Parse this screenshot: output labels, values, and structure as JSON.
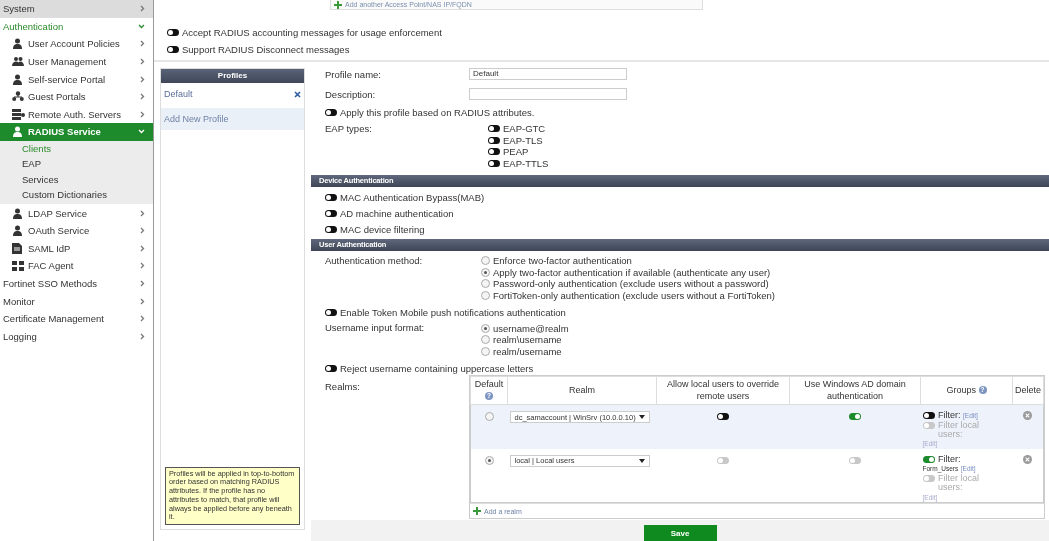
{
  "sidebar": {
    "items": [
      {
        "label": "System",
        "expanded": false,
        "hovered": true
      },
      {
        "label": "Authentication",
        "expanded": true,
        "hovered": false,
        "children": [
          {
            "label": "User Account Policies",
            "expanded": false,
            "selected": false
          },
          {
            "label": "User Management",
            "expanded": false,
            "selected": false
          },
          {
            "label": "Self-service Portal",
            "expanded": false,
            "selected": false
          },
          {
            "label": "Guest Portals",
            "expanded": false,
            "selected": false
          },
          {
            "label": "Remote Auth. Servers",
            "expanded": false,
            "selected": false
          },
          {
            "label": "RADIUS Service",
            "expanded": true,
            "selected": true,
            "children": [
              {
                "label": "Clients",
                "selected": true
              },
              {
                "label": "EAP",
                "selected": false
              },
              {
                "label": "Services",
                "selected": false
              },
              {
                "label": "Custom Dictionaries",
                "selected": false
              }
            ]
          },
          {
            "label": "LDAP Service",
            "expanded": false,
            "selected": false
          },
          {
            "label": "OAuth Service",
            "expanded": false,
            "selected": false
          },
          {
            "label": "SAML IdP",
            "expanded": false,
            "selected": false
          },
          {
            "label": "FAC Agent",
            "expanded": false,
            "selected": false
          }
        ]
      },
      {
        "label": "Fortinet SSO Methods",
        "expanded": false,
        "hovered": false
      },
      {
        "label": "Monitor",
        "expanded": false,
        "hovered": false
      },
      {
        "label": "Certificate Management",
        "expanded": false,
        "hovered": false
      },
      {
        "label": "Logging",
        "expanded": false,
        "hovered": false
      }
    ]
  },
  "top": {
    "add_link": "Add another Access Point/NAS IP/FQDN",
    "toggles": [
      {
        "label": "Accept RADIUS accounting messages for usage enforcement",
        "on": false
      },
      {
        "label": "Support RADIUS Disconnect messages",
        "on": false
      }
    ]
  },
  "profiles": {
    "title": "Profiles",
    "items": [
      {
        "label": "Default"
      }
    ],
    "add_label": "Add New Profile",
    "note": "Profiles will be applied in top-to-bottom order based on matching RADIUS attributes. If the profile has no attributes to match, that profile will always be applied before any beneath it."
  },
  "form": {
    "profile_name": {
      "label": "Profile name:",
      "value": "Default"
    },
    "description": {
      "label": "Description:"
    },
    "apply_toggle": {
      "label": "Apply this profile based on RADIUS attributes.",
      "on": false
    },
    "eap_types": {
      "label": "EAP types:",
      "options": [
        {
          "label": "EAP-GTC",
          "on": false
        },
        {
          "label": "EAP-TLS",
          "on": false
        },
        {
          "label": "PEAP",
          "on": false
        },
        {
          "label": "EAP-TTLS",
          "on": false
        }
      ]
    },
    "device_authentication": {
      "title": "Device Authentication",
      "toggles": [
        {
          "label": "MAC Authentication Bypass(MAB)",
          "on": false
        },
        {
          "label": "AD machine authentication",
          "on": false
        },
        {
          "label": "MAC device filtering",
          "on": false
        }
      ]
    },
    "user_authentication": {
      "title": "User Authentication",
      "authentication_method": {
        "label": "Authentication method:",
        "options": [
          {
            "label": "Enforce two-factor authentication",
            "selected": false
          },
          {
            "label": "Apply two-factor authentication if available (authenticate any user)",
            "selected": true
          },
          {
            "label": "Password-only authentication (exclude users without a password)",
            "selected": false
          },
          {
            "label": "FortiToken-only authentication (exclude users without a FortiToken)",
            "selected": false
          }
        ]
      },
      "token_toggle": {
        "label": "Enable Token Mobile push notifications authentication",
        "on": false
      },
      "username_format": {
        "label": "Username input format:",
        "options": [
          {
            "label": "username@realm",
            "selected": true
          },
          {
            "label": "realm\\username",
            "selected": false
          },
          {
            "label": "realm/username",
            "selected": false
          }
        ]
      },
      "reject_toggle": {
        "label": "Reject username containing uppercase letters",
        "on": false
      },
      "realms": {
        "label": "Realms:",
        "columns": [
          {
            "label": "Default",
            "help": "?"
          },
          {
            "label": "Realm"
          },
          {
            "label": "Allow local users to override remote users"
          },
          {
            "label": "Use Windows AD domain authentication"
          },
          {
            "label": "Groups",
            "help": "?"
          },
          {
            "label": "Delete"
          }
        ],
        "rows": [
          {
            "selected": false,
            "highlighted": true,
            "realm": "dc_samaccount | WinSrv (10.0.0.10)",
            "override": {
              "on": false,
              "disabled": false
            },
            "windows_ad": {
              "on": true,
              "disabled": false
            },
            "filter": {
              "on": false,
              "label": "Filter:",
              "edit": "[Edit]"
            },
            "local_filter": {
              "on": false,
              "disabled": true,
              "label": "Filter local users:",
              "edit": "[Edit]"
            }
          },
          {
            "selected": true,
            "highlighted": false,
            "realm": "local | Local users",
            "override": {
              "on": false,
              "disabled": true
            },
            "windows_ad": {
              "on": false,
              "disabled": true
            },
            "filter": {
              "on": true,
              "label": "Filter:",
              "value": "Form_Users",
              "edit": "[Edit]"
            },
            "local_filter": {
              "on": false,
              "disabled": true,
              "label": "Filter local users:",
              "edit": "[Edit]"
            }
          }
        ],
        "add_link": "Add a realm"
      }
    }
  },
  "save_button": "Save"
}
